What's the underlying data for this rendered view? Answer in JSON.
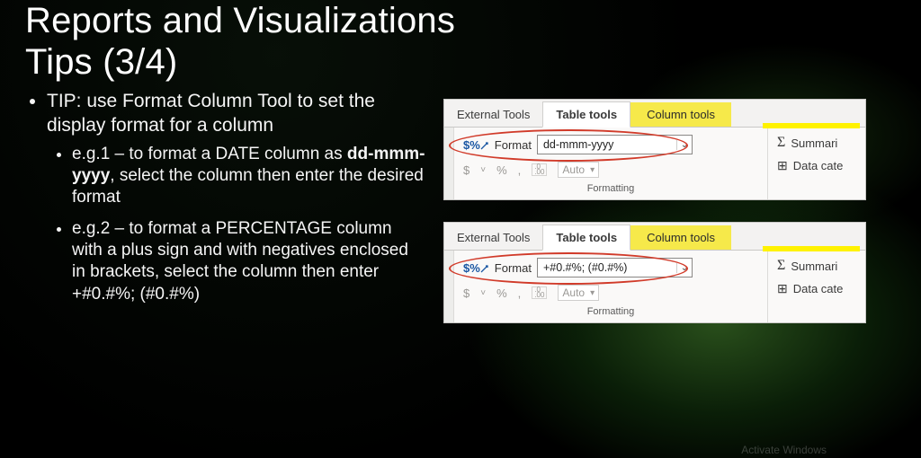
{
  "title_line1": "Reports and Visualizations",
  "title_line2": "Tips (3/4)",
  "bullet_main": "TIP: use Format Column Tool to set the display format for a column",
  "sub1_prefix": "e.g.1 – to format a DATE column as ",
  "sub1_bold": "dd-mmm-yyyy",
  "sub1_suffix": ", select the column then enter the desired format",
  "sub2": "e.g.2 – to format a PERCENTAGE column with a plus sign and with negatives enclosed in brackets, select the column then enter +#0.#%; (#0.#%)",
  "ribbon": {
    "tab_external": "External Tools",
    "tab_table": "Table tools",
    "tab_column": "Column tools",
    "format_label": "Format",
    "auto_label": "Auto",
    "group_label": "Formatting",
    "dollar": "$",
    "percent": "%",
    "comma": ",",
    "summarise": "Summari",
    "datacat": "Data cate"
  },
  "format_value_1": "dd-mmm-yyyy",
  "format_value_2": "+#0.#%; (#0.#%)",
  "watermark": "Activate Windows"
}
